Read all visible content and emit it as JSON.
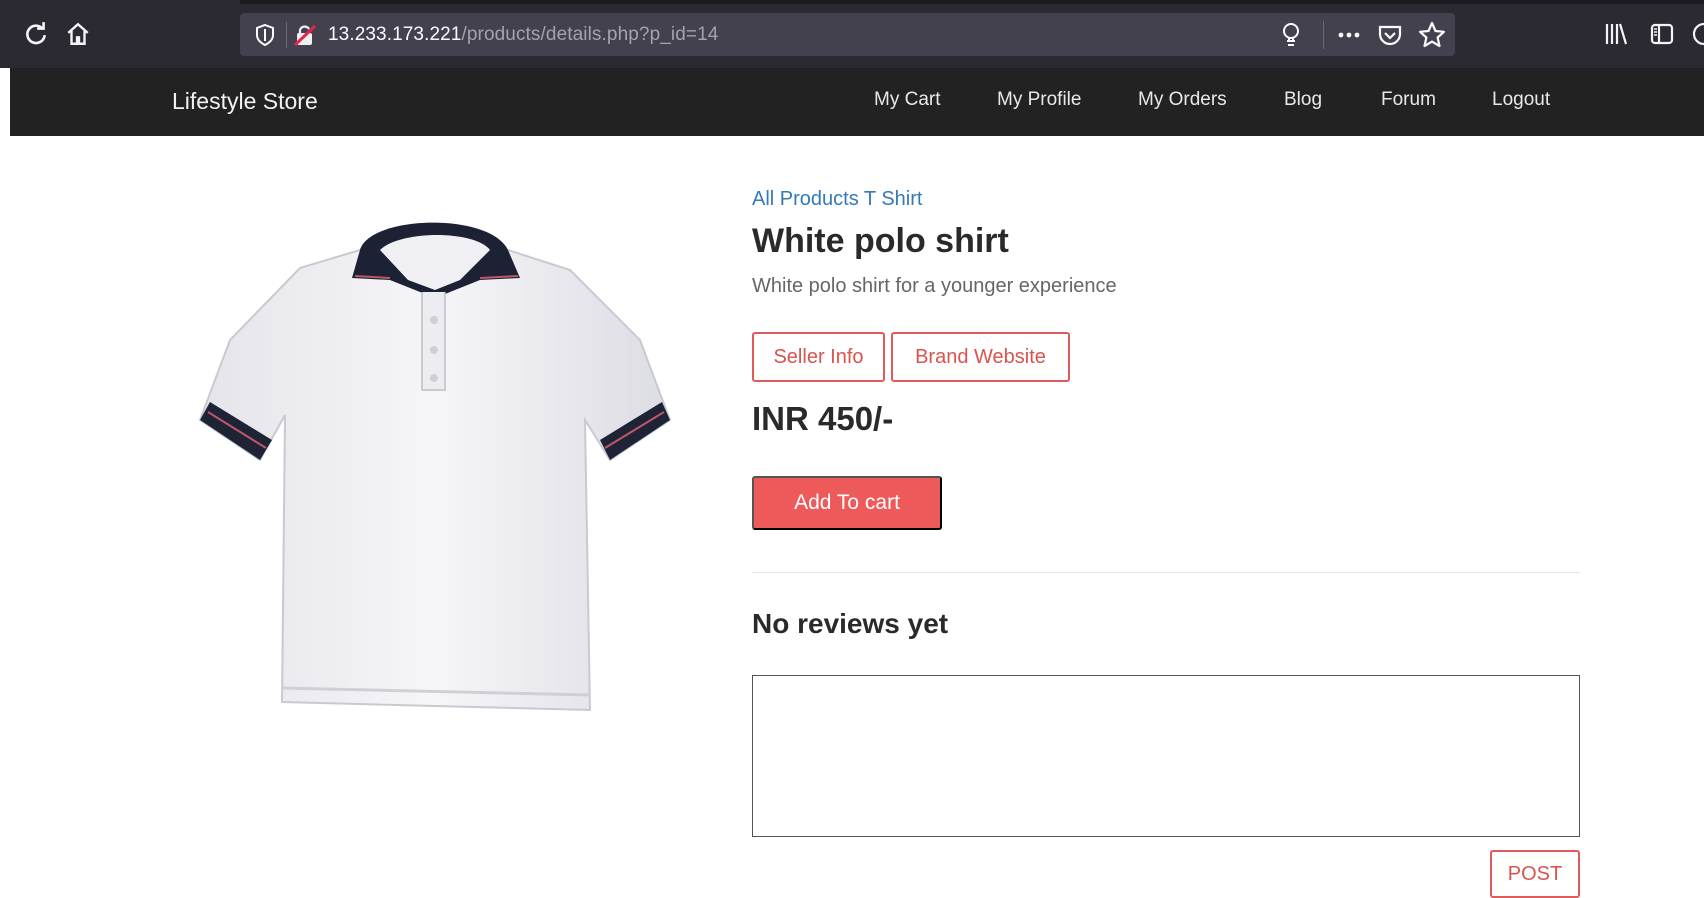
{
  "browser": {
    "url_host": "13.233.173.221",
    "url_path": "/products/details.php?p_id=14",
    "icons": {
      "reload": "reload-icon",
      "home": "home-icon",
      "shield": "shield-icon",
      "insecure_lock": "insecure-lock-icon",
      "bulb": "bulb-icon",
      "more": "more-icon",
      "pocket": "pocket-icon",
      "star": "star-icon",
      "library": "library-icon",
      "sidebar": "sidebar-icon",
      "account": "account-icon"
    }
  },
  "navbar": {
    "brand": "Lifestyle Store",
    "links": [
      "My Cart",
      "My Profile",
      "My Orders",
      "Blog",
      "Forum",
      "Logout"
    ]
  },
  "product": {
    "breadcrumb": "All Products T Shirt",
    "title": "White polo shirt",
    "description": "White polo shirt for a younger experience",
    "seller_info_label": "Seller Info",
    "brand_website_label": "Brand Website",
    "price": "INR 450/-",
    "add_to_cart_label": "Add To cart"
  },
  "reviews": {
    "heading": "No reviews yet",
    "textarea_value": "",
    "post_label": "POST"
  },
  "colors": {
    "browser_bg": "#2b2a33",
    "urlbar_bg": "#42414d",
    "navbar_bg": "#222222",
    "accent_red": "#ee5a5a",
    "link_blue": "#337ab7"
  }
}
